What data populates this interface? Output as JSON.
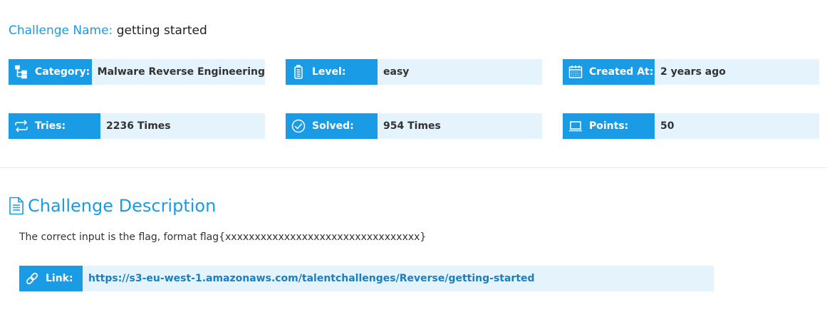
{
  "challenge": {
    "name_label": "Challenge Name:",
    "name_value": "getting started"
  },
  "info": {
    "category": {
      "label": "Category:",
      "value": "Malware Reverse Engineering",
      "icon": "sitemap-icon"
    },
    "level": {
      "label": "Level:",
      "value": "easy",
      "icon": "battery-icon"
    },
    "created": {
      "label": "Created At:",
      "value": "2 years ago",
      "icon": "calendar-icon"
    },
    "tries": {
      "label": "Tries:",
      "value": "2236 Times",
      "icon": "repeat-icon"
    },
    "solved": {
      "label": "Solved:",
      "value": "954 Times",
      "icon": "check-circle-icon"
    },
    "points": {
      "label": "Points:",
      "value": "50",
      "icon": "laptop-icon"
    }
  },
  "description": {
    "heading": "Challenge Description",
    "text": "The correct input is the flag, format flag{xxxxxxxxxxxxxxxxxxxxxxxxxxxxxxxxx}",
    "link_label": "Link:",
    "link_url": "https://s3-eu-west-1.amazonaws.com/talentchallenges/Reverse/getting-started"
  },
  "colors": {
    "accent": "#1a9be6",
    "value_bg": "#e5f3fd",
    "link_text": "#1a7fbf"
  }
}
